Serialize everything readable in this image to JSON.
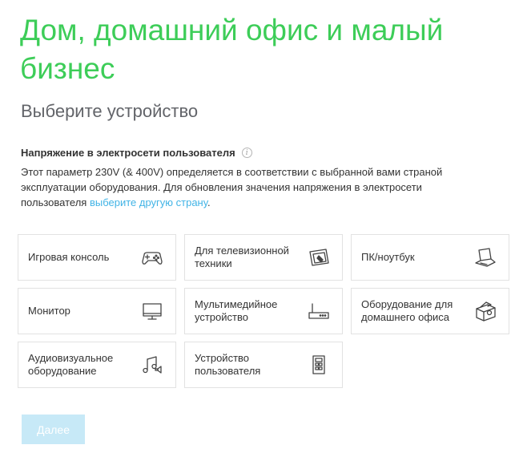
{
  "header": {
    "title": "Дом, домашний офис и малый бизнес",
    "subtitle": "Выберите устройство"
  },
  "voltage": {
    "heading": "Напряжение в электросети пользователя",
    "info_icon": "info-icon",
    "text": "Этот параметр 230V (& 400V) определяется в соответствии с выбранной вами страной эксплуатации оборудования. Для обновления значения напряжения в электросети пользователя ",
    "link": "выберите другую страну",
    "text_end": "."
  },
  "devices": [
    {
      "label": "Игровая консоль",
      "icon": "gamepad-icon"
    },
    {
      "label": "Для телевизионной техники",
      "icon": "tv-remote-icon"
    },
    {
      "label": "ПК/ноутбук",
      "icon": "laptop-icon"
    },
    {
      "label": "Монитор",
      "icon": "monitor-icon"
    },
    {
      "label": "Мультимедийное устройство",
      "icon": "router-icon"
    },
    {
      "label": "Оборудование для домашнего офиса",
      "icon": "printer-icon"
    },
    {
      "label": "Аудиовизуальное оборудование",
      "icon": "music-icon"
    },
    {
      "label": "Устройство пользователя",
      "icon": "device-panel-icon"
    }
  ],
  "footer": {
    "next_label": "Далее"
  },
  "colors": {
    "title_green": "#3dcd58",
    "link_blue": "#42b4e6",
    "button_disabled": "#c7e9f7"
  }
}
